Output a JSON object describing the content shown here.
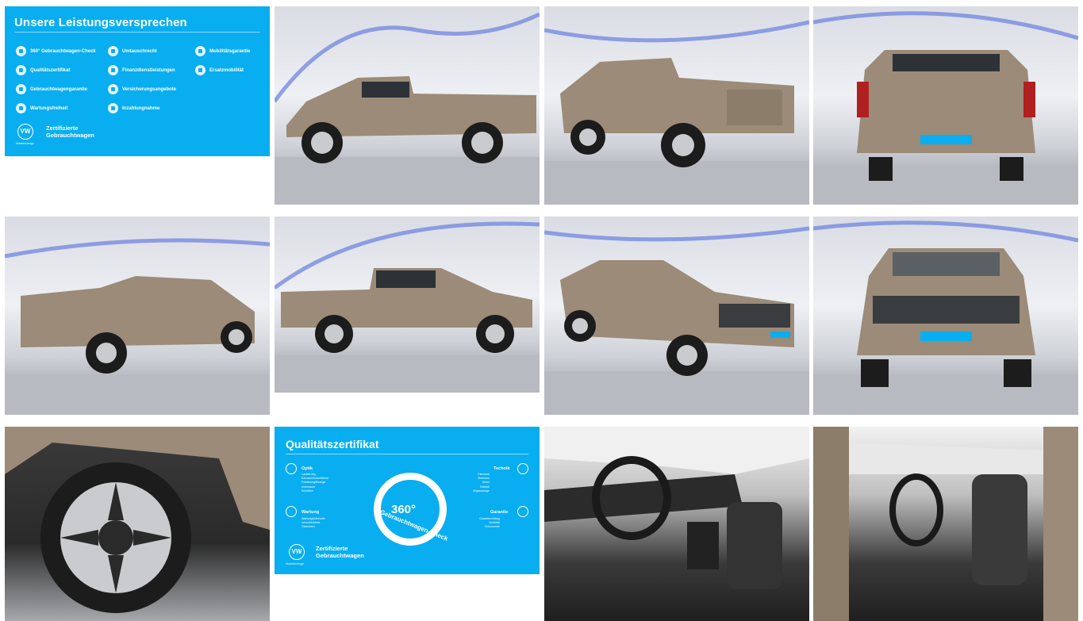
{
  "gallery": {
    "colors": {
      "accent": "#08aef0",
      "body": "#9b8b78",
      "tire": "#1c1c1c",
      "rim": "#c9cbce"
    },
    "leistungs_card": {
      "title": "Unsere Leistungsversprechen",
      "features": [
        "360° Gebrauchtwagen-Check",
        "Umtauschrecht",
        "Mobilitätsgarantie",
        "Qualitätszertifikat",
        "Finanzdienstleistungen",
        "Ersatzmobilität",
        "Gebrauchtwagengarantie",
        "Versicherungsangebote",
        "Wartungsfreiheit",
        "Inzahlungnahme"
      ],
      "cert_line1": "Zertifizierte",
      "cert_line2": "Gebrauchtwagen",
      "logo_text": "VW",
      "brand_small": "Nutzfahrzeuge"
    },
    "quality_card": {
      "title": "Qualitätszertifikat",
      "ring_number": "360°",
      "ring_text": "Gebrauchtwagen-Check",
      "left_top_label": "Optik",
      "left_top_items": [
        "Lackierung",
        "Karosserieoberfläche",
        "Polsterung/Bezüge",
        "Innenraum",
        "Scheiben"
      ],
      "left_bottom_label": "Wartung",
      "left_bottom_items": [
        "Wartungsintervalle",
        "Verschleißteile",
        "Ölwechsel"
      ],
      "right_top_label": "Technik",
      "right_top_items": [
        "Fahrwerk",
        "Bremsen",
        "Motor",
        "Elektrik",
        "Abgasanlage"
      ],
      "right_bottom_label": "Garantie",
      "right_bottom_items": [
        "Garantieumfang",
        "Mobilität",
        "Dokumente"
      ],
      "cert_line1": "Zertifizierte",
      "cert_line2": "Gebrauchtwagen",
      "logo_text": "VW",
      "brand_small": "Nutzfahrzeuge"
    },
    "photos": [
      {
        "view": "side-left"
      },
      {
        "view": "rear-three-quarter"
      },
      {
        "view": "rear"
      },
      {
        "view": "rear-three-quarter-left"
      },
      {
        "view": "side-left-2"
      },
      {
        "view": "front-three-quarter"
      },
      {
        "view": "front"
      },
      {
        "view": "wheel"
      },
      {
        "view": "interior-driver"
      },
      {
        "view": "interior-door"
      }
    ]
  }
}
